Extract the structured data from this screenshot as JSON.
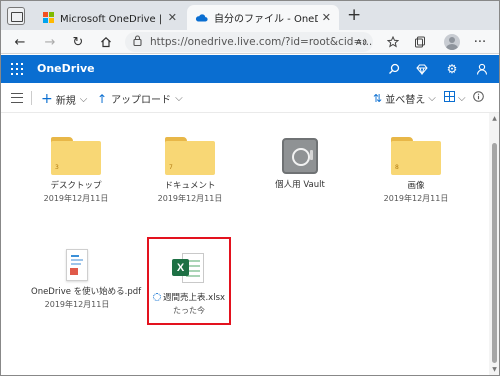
{
  "browser": {
    "tabs": [
      {
        "title": "Microsoft OneDrive | 無料のクラウ",
        "active": false
      },
      {
        "title": "自分のファイル - OneDrive",
        "active": true
      }
    ],
    "url": "https://onedrive.live.com/?id=root&cid=..."
  },
  "onedrive": {
    "app_title": "OneDrive",
    "commands": {
      "new_label": "新規",
      "upload_label": "アップロード",
      "sort_label": "並べ替え"
    }
  },
  "files": [
    {
      "name": "デスクトップ",
      "date": "2019年12月11日",
      "type": "folder",
      "count": "3"
    },
    {
      "name": "ドキュメント",
      "date": "2019年12月11日",
      "type": "folder",
      "count": "7"
    },
    {
      "name": "個人用 Vault",
      "date": "",
      "type": "vault"
    },
    {
      "name": "画像",
      "date": "2019年12月11日",
      "type": "folder",
      "count": "8"
    },
    {
      "name": "OneDrive を使い始める.pdf",
      "date": "2019年12月11日",
      "type": "pdf"
    },
    {
      "name": "週間売上表.xlsx",
      "date": "たった今",
      "type": "xlsx",
      "syncing": true
    }
  ],
  "colors": {
    "accent": "#0a6ed1",
    "folder": "#f8d775",
    "highlight": "#e3121e",
    "excel": "#1d7044"
  }
}
